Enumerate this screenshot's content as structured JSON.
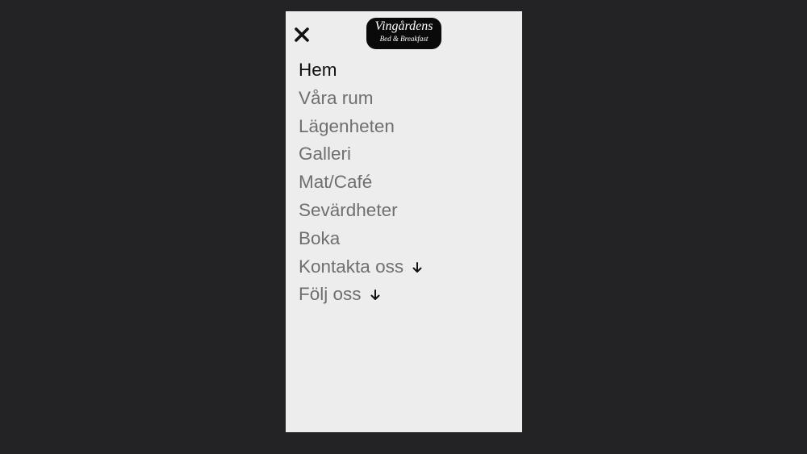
{
  "logo": {
    "title": "Vingårdens",
    "subtitle": "Bed & Breakfast"
  },
  "close_icon": "close-icon",
  "nav": {
    "items": [
      {
        "label": "Hem",
        "active": true
      },
      {
        "label": "Våra rum",
        "active": false
      },
      {
        "label": "Lägenheten",
        "active": false
      },
      {
        "label": "Galleri",
        "active": false
      },
      {
        "label": "Mat/Café",
        "active": false
      },
      {
        "label": "Sevärdheter",
        "active": false
      },
      {
        "label": "Boka",
        "active": false
      },
      {
        "label": "Kontakta oss",
        "active": false,
        "has_submenu": true
      },
      {
        "label": "Följ oss",
        "active": false,
        "has_submenu": true
      }
    ]
  },
  "colors": {
    "background": "#232326",
    "panel": "#ededed",
    "active_text": "#111111",
    "inactive_text": "#6f6f6f"
  }
}
